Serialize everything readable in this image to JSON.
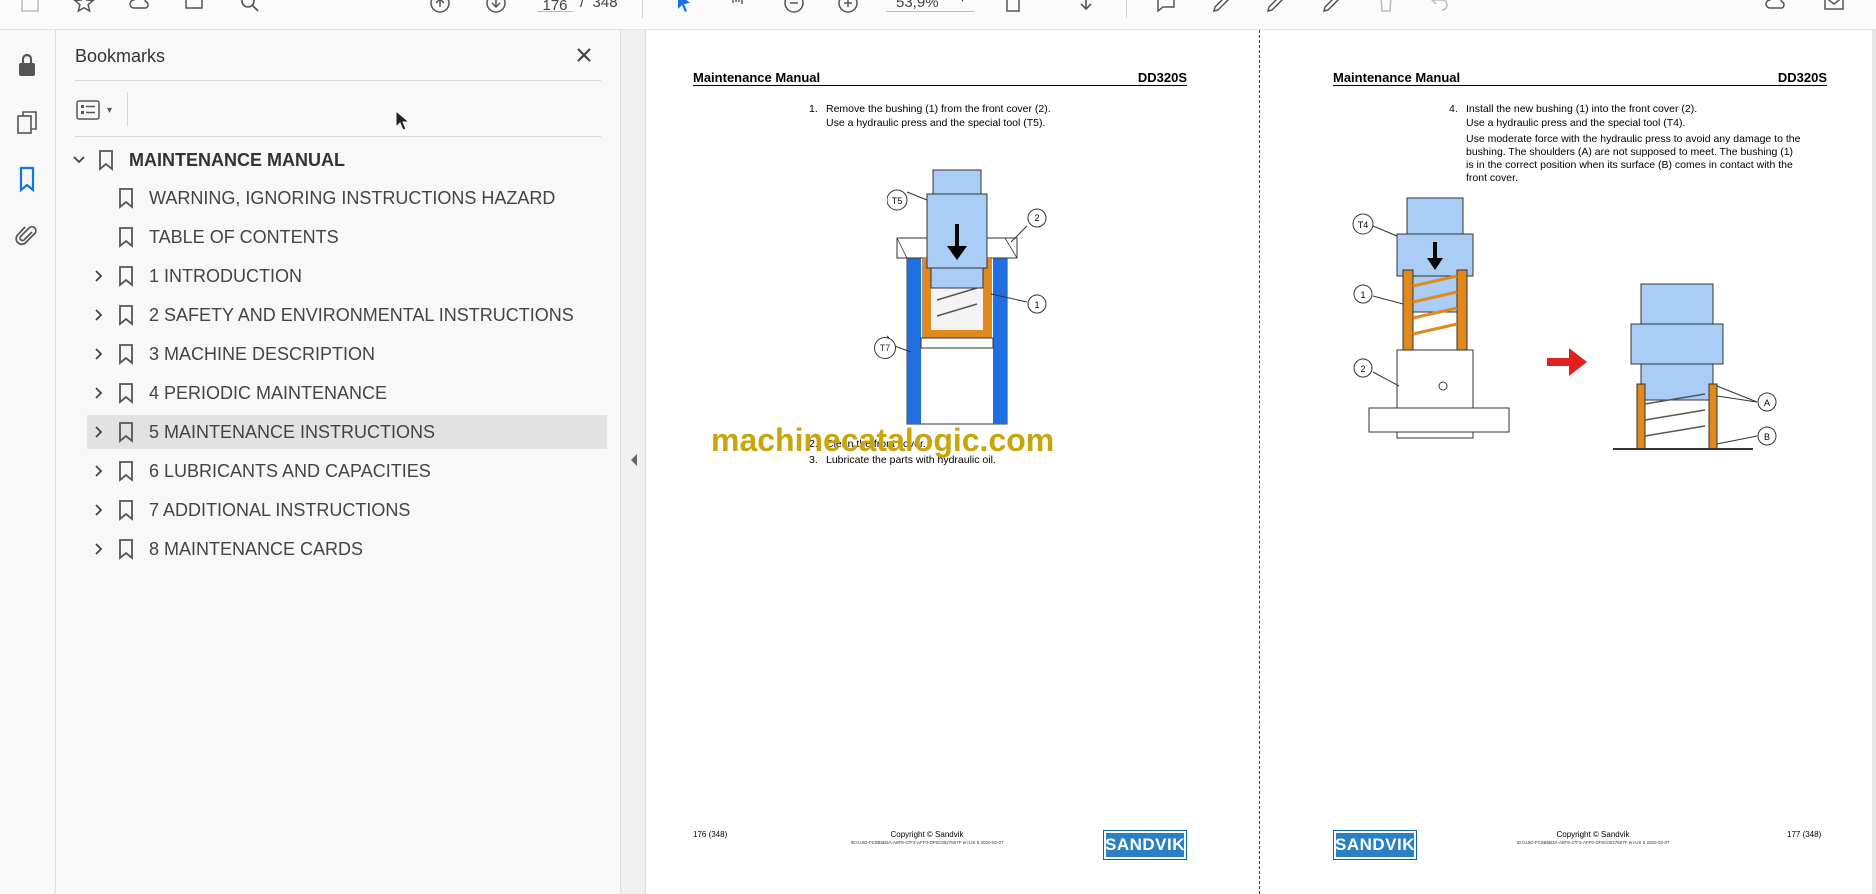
{
  "toolbar": {
    "page_current": "176",
    "page_separator": "/",
    "page_total": "348",
    "zoom": "53,9%"
  },
  "rail": {
    "icons": [
      "lock-icon",
      "pages-icon",
      "bookmark-icon",
      "attachment-icon"
    ]
  },
  "bookmarks": {
    "title": "Bookmarks",
    "root": "MAINTENANCE MANUAL",
    "items": [
      {
        "label": "WARNING, IGNORING INSTRUCTIONS HAZARD",
        "expandable": false
      },
      {
        "label": "TABLE OF CONTENTS",
        "expandable": false
      },
      {
        "label": "1 INTRODUCTION",
        "expandable": true
      },
      {
        "label": "2 SAFETY AND ENVIRONMENTAL INSTRUCTIONS",
        "expandable": true
      },
      {
        "label": "3 MACHINE DESCRIPTION",
        "expandable": true
      },
      {
        "label": "4 PERIODIC MAINTENANCE",
        "expandable": true
      },
      {
        "label": "5 MAINTENANCE INSTRUCTIONS",
        "expandable": true,
        "selected": true
      },
      {
        "label": "6 LUBRICANTS AND CAPACITIES",
        "expandable": true
      },
      {
        "label": "7 ADDITIONAL INSTRUCTIONS",
        "expandable": true
      },
      {
        "label": "8 MAINTENANCE CARDS",
        "expandable": true
      }
    ]
  },
  "left_page": {
    "header_left": "Maintenance Manual",
    "header_right": "DD320S",
    "steps": [
      {
        "num": "1.",
        "lines": [
          "Remove the bushing (1) from the front cover (2).",
          "Use a hydraulic press and the special tool (T5)."
        ]
      },
      {
        "num": "2.",
        "lines": [
          "Clean the front cover."
        ]
      },
      {
        "num": "3.",
        "lines": [
          "Lubricate the parts with hydraulic oil."
        ]
      }
    ],
    "callouts": [
      "T5",
      "2",
      "1",
      "T7"
    ],
    "footer_page": "176 (348)",
    "footer_copy": "Copyright © Sandvik",
    "footer_id": "ID:GUID-FC6B5B3A-A8F9-47F3-AFF0-DF6C0027607F en-US 5 2020-02-07",
    "logo": "SANDVIK"
  },
  "right_page": {
    "header_left": "Maintenance Manual",
    "header_right": "DD320S",
    "steps": [
      {
        "num": "4.",
        "lines": [
          "Install the new bushing (1) into the front cover (2).",
          "Use a hydraulic press and the special tool (T4).",
          "Use moderate force with the hydraulic press to avoid any damage to the",
          "bushing. The shoulders (A) are not supposed to meet. The bushing (1)",
          "is in the correct position when its surface (B) comes in contact with the",
          "front cover."
        ]
      }
    ],
    "callouts": [
      "T4",
      "1",
      "2",
      "A",
      "B"
    ],
    "footer_page": "177 (348)",
    "footer_copy": "Copyright © Sandvik",
    "footer_id": "ID:GUID-FC6B5B3A-A8F9-47F3-AFF0-DF6C0027607F en-US 5 2020-02-07",
    "logo": "SANDVIK"
  },
  "watermark": "machinecatalogic.com",
  "colors": {
    "accent": "#1473e6",
    "part_blue": "#a9cdf4",
    "bushing_orange": "#e08a1e",
    "sleeve_blue": "#1f6fe0",
    "arrow_red": "#e3201b",
    "logo_blue": "#2a7fc5",
    "watermark": "#c9a50c"
  }
}
